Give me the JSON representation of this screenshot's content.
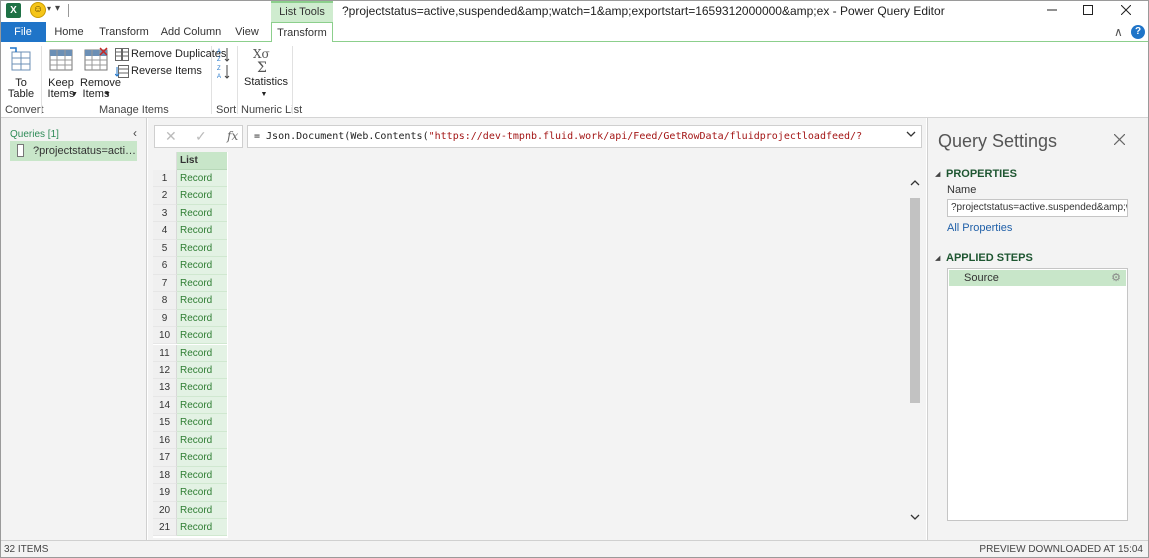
{
  "titlebar": {
    "app_icon": "X",
    "smiley": "☺",
    "window_title": "?projectstatus=active,suspended&amp;watch=1&amp;exportstart=1659312000000&amp;ex - Power Query Editor",
    "context_tab_group": "List Tools",
    "min_icon": "minimize-icon",
    "max_icon": "maximize-icon",
    "close_icon": "close-icon"
  },
  "tabs": {
    "file": "File",
    "home": "Home",
    "transform": "Transform",
    "add_column": "Add Column",
    "view": "View",
    "list_transform": "Transform"
  },
  "ribbon": {
    "convert": {
      "to_table_line1": "To",
      "to_table_line2": "Table",
      "group": "Convert"
    },
    "manage": {
      "keep_line1": "Keep",
      "keep_line2": "Items",
      "remove_line1": "Remove",
      "remove_line2": "Items",
      "remove_duplicates": "Remove Duplicates",
      "reverse_items": "Reverse Items",
      "group": "Manage Items"
    },
    "sort": {
      "group": "Sort"
    },
    "numeric": {
      "statistics": "Statistics",
      "group": "Numeric List"
    }
  },
  "queries": {
    "title": "Queries [1]",
    "item": "?projectstatus=active..."
  },
  "formula": {
    "fx": "fx",
    "prefix": "= Json.Document(Web.Contents(",
    "string": "\"https://dev-tmpnb.fluid.work/api/Feed/GetRowData/fluidprojectloadfeed/?"
  },
  "grid": {
    "column_header": "List",
    "rows": [
      {
        "n": "1",
        "v": "Record"
      },
      {
        "n": "2",
        "v": "Record"
      },
      {
        "n": "3",
        "v": "Record"
      },
      {
        "n": "4",
        "v": "Record"
      },
      {
        "n": "5",
        "v": "Record"
      },
      {
        "n": "6",
        "v": "Record"
      },
      {
        "n": "7",
        "v": "Record"
      },
      {
        "n": "8",
        "v": "Record"
      },
      {
        "n": "9",
        "v": "Record"
      },
      {
        "n": "10",
        "v": "Record"
      },
      {
        "n": "11",
        "v": "Record"
      },
      {
        "n": "12",
        "v": "Record"
      },
      {
        "n": "13",
        "v": "Record"
      },
      {
        "n": "14",
        "v": "Record"
      },
      {
        "n": "15",
        "v": "Record"
      },
      {
        "n": "16",
        "v": "Record"
      },
      {
        "n": "17",
        "v": "Record"
      },
      {
        "n": "18",
        "v": "Record"
      },
      {
        "n": "19",
        "v": "Record"
      },
      {
        "n": "20",
        "v": "Record"
      },
      {
        "n": "21",
        "v": "Record"
      }
    ]
  },
  "settings": {
    "title": "Query Settings",
    "properties": "PROPERTIES",
    "name_label": "Name",
    "name_value": "?projectstatus=active.suspended&amp;w...",
    "all_properties": "All Properties",
    "applied_steps": "APPLIED STEPS",
    "step_source": "Source"
  },
  "status": {
    "items": "32 ITEMS",
    "preview": "PREVIEW DOWNLOADED AT 15:04"
  }
}
